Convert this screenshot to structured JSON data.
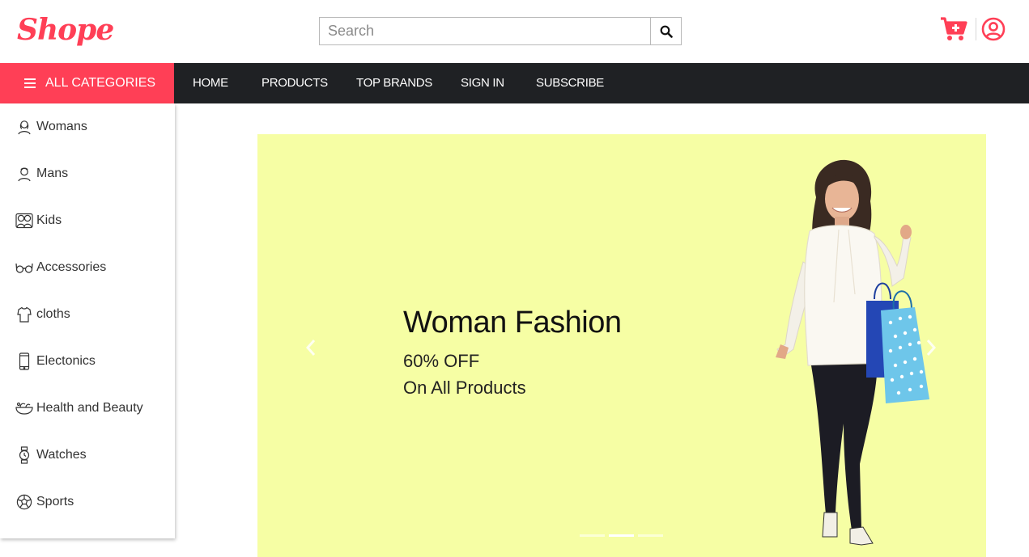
{
  "brand": {
    "name": "Shope",
    "color": "#ff3f56"
  },
  "search": {
    "placeholder": "Search",
    "value": ""
  },
  "header": {
    "cart_icon": "cart-plus-icon",
    "account_icon": "user-circle-icon"
  },
  "navbar": {
    "all_categories_label": "ALL CATEGORIES",
    "links": [
      {
        "label": "HOME"
      },
      {
        "label": "PRODUCTS"
      },
      {
        "label": "TOP BRANDS"
      },
      {
        "label": "SIGN IN"
      },
      {
        "label": "SUBSCRIBE"
      }
    ],
    "background": "#1f2124"
  },
  "sidebar": {
    "items": [
      {
        "label": "Womans",
        "icon": "woman-icon"
      },
      {
        "label": "Mans",
        "icon": "man-icon"
      },
      {
        "label": "Kids",
        "icon": "kids-icon"
      },
      {
        "label": "Accessories",
        "icon": "glasses-icon"
      },
      {
        "label": "cloths",
        "icon": "shirt-icon"
      },
      {
        "label": "Electonics",
        "icon": "phone-icon"
      },
      {
        "label": "Health and Beauty",
        "icon": "beauty-bowl-icon"
      },
      {
        "label": "Watches",
        "icon": "watch-icon"
      },
      {
        "label": "Sports",
        "icon": "football-icon"
      }
    ]
  },
  "banner": {
    "title": "Woman Fashion",
    "discount": "60% OFF",
    "subtitle": "On All Products",
    "background": "#f6fea4",
    "slides": 3,
    "active_slide": 2
  }
}
